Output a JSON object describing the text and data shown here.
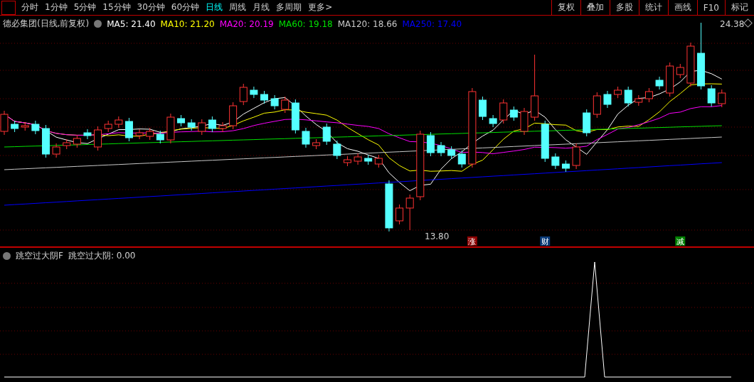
{
  "menu_bar": {
    "timeframes": [
      {
        "label": "分时",
        "selected": false
      },
      {
        "label": "1分钟",
        "selected": false
      },
      {
        "label": "5分钟",
        "selected": false
      },
      {
        "label": "15分钟",
        "selected": false
      },
      {
        "label": "30分钟",
        "selected": false
      },
      {
        "label": "60分钟",
        "selected": false
      },
      {
        "label": "日线",
        "selected": true
      },
      {
        "label": "周线",
        "selected": false
      },
      {
        "label": "月线",
        "selected": false
      },
      {
        "label": "多周期",
        "selected": false
      },
      {
        "label": "更多>",
        "selected": false
      }
    ],
    "tools": [
      "复权",
      "叠加",
      "多股",
      "统计",
      "画线",
      "F10",
      "标记"
    ]
  },
  "main_chart": {
    "title": "德必集团(日线,前复权)",
    "indicators": [
      {
        "label": "MA5: 21.40",
        "color": "#ffffff"
      },
      {
        "label": "MA10: 21.20",
        "color": "#ffff00"
      },
      {
        "label": "MA20: 20.19",
        "color": "#ff00ff"
      },
      {
        "label": "MA60: 19.18",
        "color": "#00e000"
      },
      {
        "label": "MA120: 18.66",
        "color": "#c8c8c8"
      },
      {
        "label": "MA250: 17.40",
        "color": "#0000ff"
      }
    ],
    "high_label": "24.38",
    "low_label": "13.80",
    "signals": [
      {
        "label": "涨",
        "color": "#8b0000"
      },
      {
        "label": "财",
        "color": "#0a3a78"
      },
      {
        "label": "减",
        "color": "#008000"
      }
    ]
  },
  "indicator_pane": {
    "title": "跳空过大阴F",
    "reading": "跳空过大阴: 0.00"
  }
}
